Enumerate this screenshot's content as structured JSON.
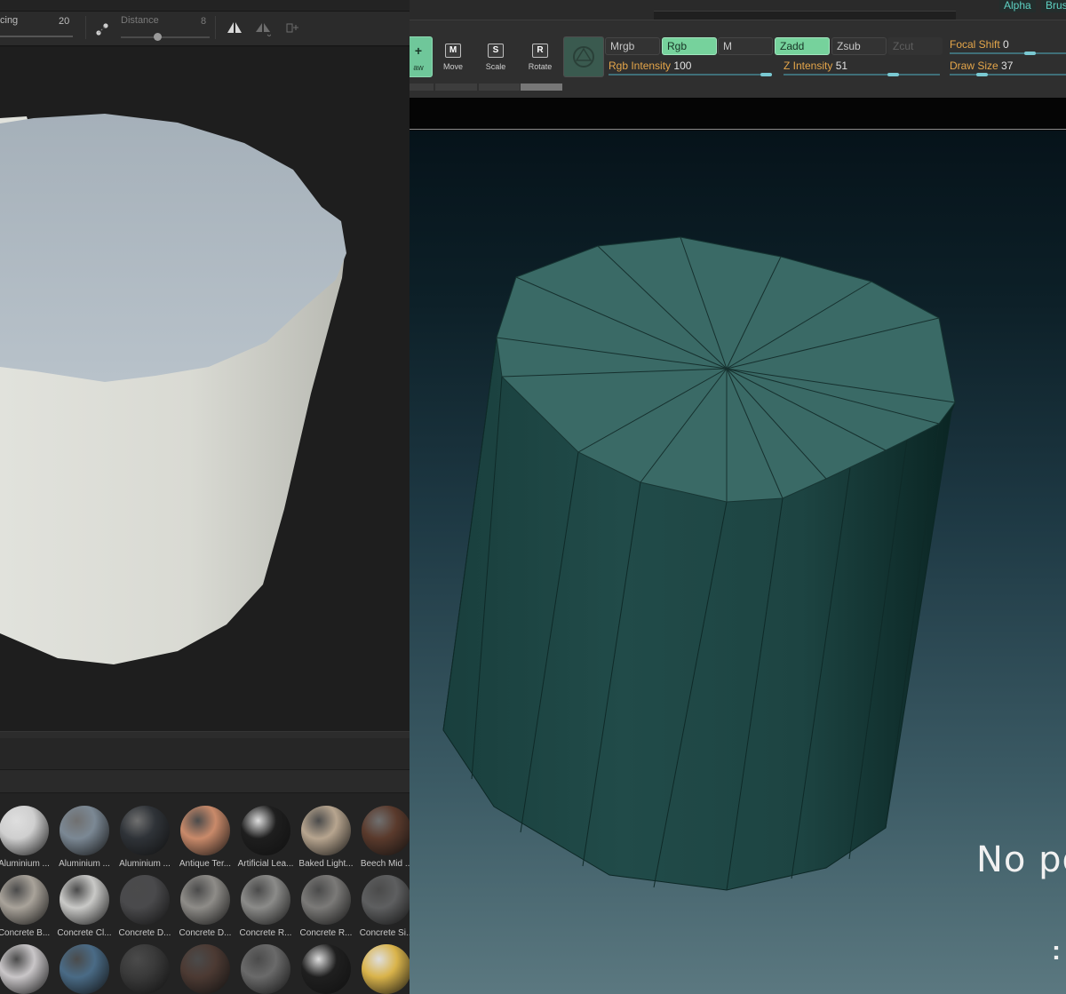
{
  "left_app": {
    "toolbar": {
      "spacing_label": "cing",
      "spacing_value": "20",
      "distance_label": "Distance",
      "distance_value": "8"
    },
    "materials": [
      {
        "label": "Aluminium ...",
        "color": "#cfcfcf",
        "style": "chrome"
      },
      {
        "label": "Aluminium ...",
        "color": "#7b8894",
        "style": "satin"
      },
      {
        "label": "Aluminium ...",
        "color": "#2f3338",
        "style": "dark"
      },
      {
        "label": "Antique Ter...",
        "color": "#c98a6a",
        "style": "matte"
      },
      {
        "label": "Artificial Lea...",
        "color": "#1e1e1e",
        "style": "gloss"
      },
      {
        "label": "Baked Light...",
        "color": "#b7a58f",
        "style": "matte"
      },
      {
        "label": "Beech Mid ...",
        "color": "#5a3a2c",
        "style": "wood"
      },
      {
        "label": "Concrete B...",
        "color": "#a9a39a",
        "style": "rough"
      },
      {
        "label": "Concrete Cl...",
        "color": "#c9c9c7",
        "style": "matte"
      },
      {
        "label": "Concrete D...",
        "color": "#4a4a4c",
        "style": "rough"
      },
      {
        "label": "Concrete D...",
        "color": "#8e8c88",
        "style": "rough"
      },
      {
        "label": "Concrete R...",
        "color": "#8b8b89",
        "style": "matte"
      },
      {
        "label": "Concrete R...",
        "color": "#7b7a78",
        "style": "matte"
      },
      {
        "label": "Concrete Si...",
        "color": "#5e5f60",
        "style": "matte"
      },
      {
        "label": "",
        "color": "#c9c6c8",
        "style": "fabric"
      },
      {
        "label": "",
        "color": "#4a6b86",
        "style": "matte"
      },
      {
        "label": "",
        "color": "#3a3a3a",
        "style": "matte"
      },
      {
        "label": "",
        "color": "#4c3a33",
        "style": "matte"
      },
      {
        "label": "",
        "color": "#6a6a6a",
        "style": "rough"
      },
      {
        "label": "",
        "color": "#1f1f1f",
        "style": "gloss"
      },
      {
        "label": "",
        "color": "#d9b34a",
        "style": "gold"
      }
    ]
  },
  "right_app": {
    "tabs": [
      "Alpha",
      "Brus"
    ],
    "tools": [
      {
        "label": "aw",
        "icon": "draw-icon",
        "glyph": "+",
        "active": true
      },
      {
        "label": "Move",
        "icon": "move-icon",
        "glyph": "M",
        "active": false
      },
      {
        "label": "Scale",
        "icon": "scale-icon",
        "glyph": "S",
        "active": false
      },
      {
        "label": "Rotate",
        "icon": "rotate-icon",
        "glyph": "R",
        "active": false
      }
    ],
    "channel_buttons": {
      "mrgb": "Mrgb",
      "rgb": "Rgb",
      "m": "M",
      "zadd": "Zadd",
      "zsub": "Zsub",
      "zcut": "Zcut"
    },
    "rgb_intensity": {
      "label": "Rgb Intensity",
      "value": "100"
    },
    "z_intensity": {
      "label": "Z Intensity",
      "value": "51"
    },
    "focal_shift": {
      "label": "Focal Shift",
      "value": "0"
    },
    "draw_size": {
      "label": "Draw Size",
      "value": "37"
    },
    "canvas_text": "No pol",
    "canvas_text2": ":"
  }
}
